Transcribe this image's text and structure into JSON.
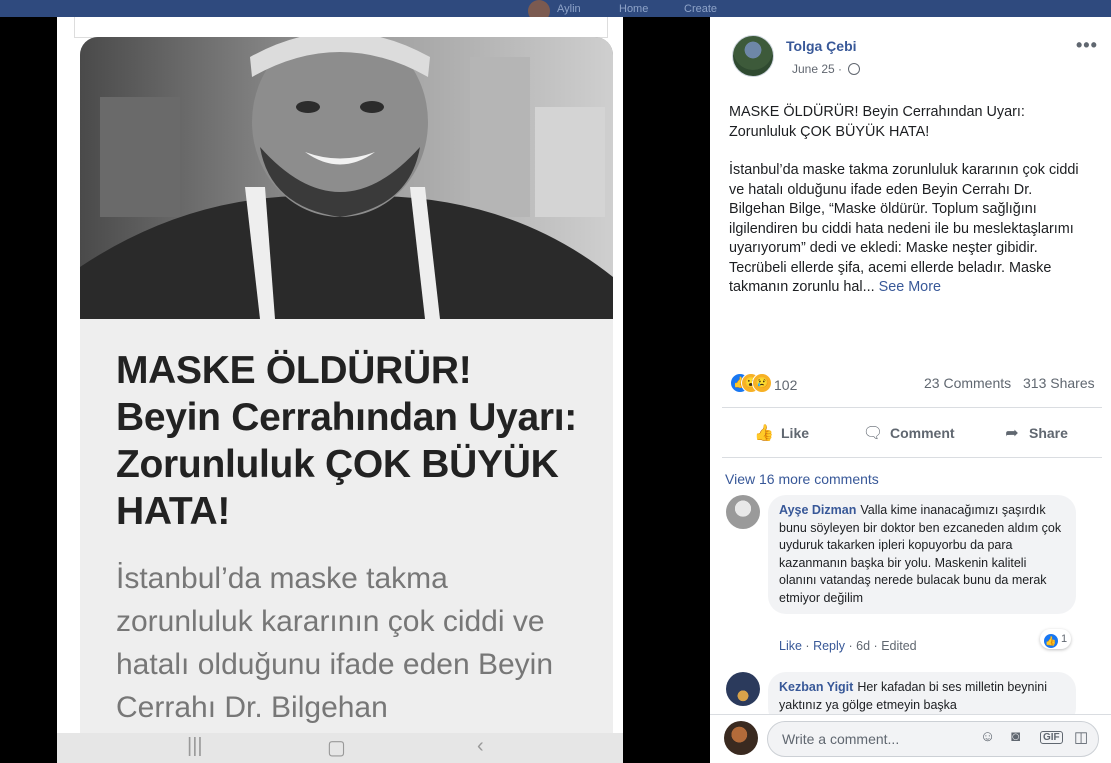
{
  "topbar": {
    "name": "Aylin",
    "home": "Home",
    "create": "Create"
  },
  "phone": {
    "headline": "MASKE ÖLDÜRÜR! Beyin Cerrahından Uyarı: Zorunluluk ÇOK BÜYÜK HATA!",
    "body": "İstanbul’da maske takma zorunluluk kararının çok ciddi ve hatalı olduğunu ifade eden Beyin Cerrahı Dr. Bilgehan"
  },
  "post": {
    "author": "Tolga Çebi",
    "date": "June 25",
    "more_label": "•••",
    "paragraph1": "MASKE ÖLDÜRÜR! Beyin Cerrahından Uyarı: Zorunluluk ÇOK BÜYÜK HATA!",
    "paragraph2": "İstanbul’da maske takma zorunluluk kararının çok ciddi ve hatalı olduğunu ifade eden Beyin Cerrahı Dr. Bilgehan Bilge, “Maske öldürür. Toplum sağlığını ilgilendiren bu ciddi hata nedeni ile bu meslektaşlarımı uyarıyorum” dedi ve ekledi: Maske neşter gibidir. Tecrübeli ellerde şifa, acemi ellerde beladır. Maske takmanın zorunlu hal...",
    "see_more": "See More",
    "reaction_count": "102",
    "comments": "23 Comments",
    "shares": "313 Shares",
    "reaction_icons": [
      "like-icon",
      "wow-icon",
      "sad-icon"
    ]
  },
  "actions": {
    "like": "Like",
    "comment": "Comment",
    "share": "Share"
  },
  "comments": {
    "view_more": "View 16 more comments",
    "items": [
      {
        "name": "Ayşe Dizman",
        "text": "Valla kime inanacağımızı şaşırdık bunu söyleyen bir doktor ben ezcaneden aldım çok uyduruk takarken ipleri kopuyorbu da para kazanmanın başka bir yolu. Maskenin kaliteli olanını vatandaş nerede bulacak bunu da merak etmiyor değilim",
        "like": "Like",
        "reply": "Reply",
        "time": "6d",
        "edited": "Edited",
        "reactions": "1"
      },
      {
        "name": "Kezban Yigit",
        "text": "Her kafadan bi ses milletin beynini yaktınız ya gölge etmeyin başka"
      }
    ],
    "write_placeholder": "Write a comment..."
  },
  "colors": {
    "link": "#385898",
    "like_blue": "#1877f2",
    "topbar": "#2f4a7e"
  }
}
